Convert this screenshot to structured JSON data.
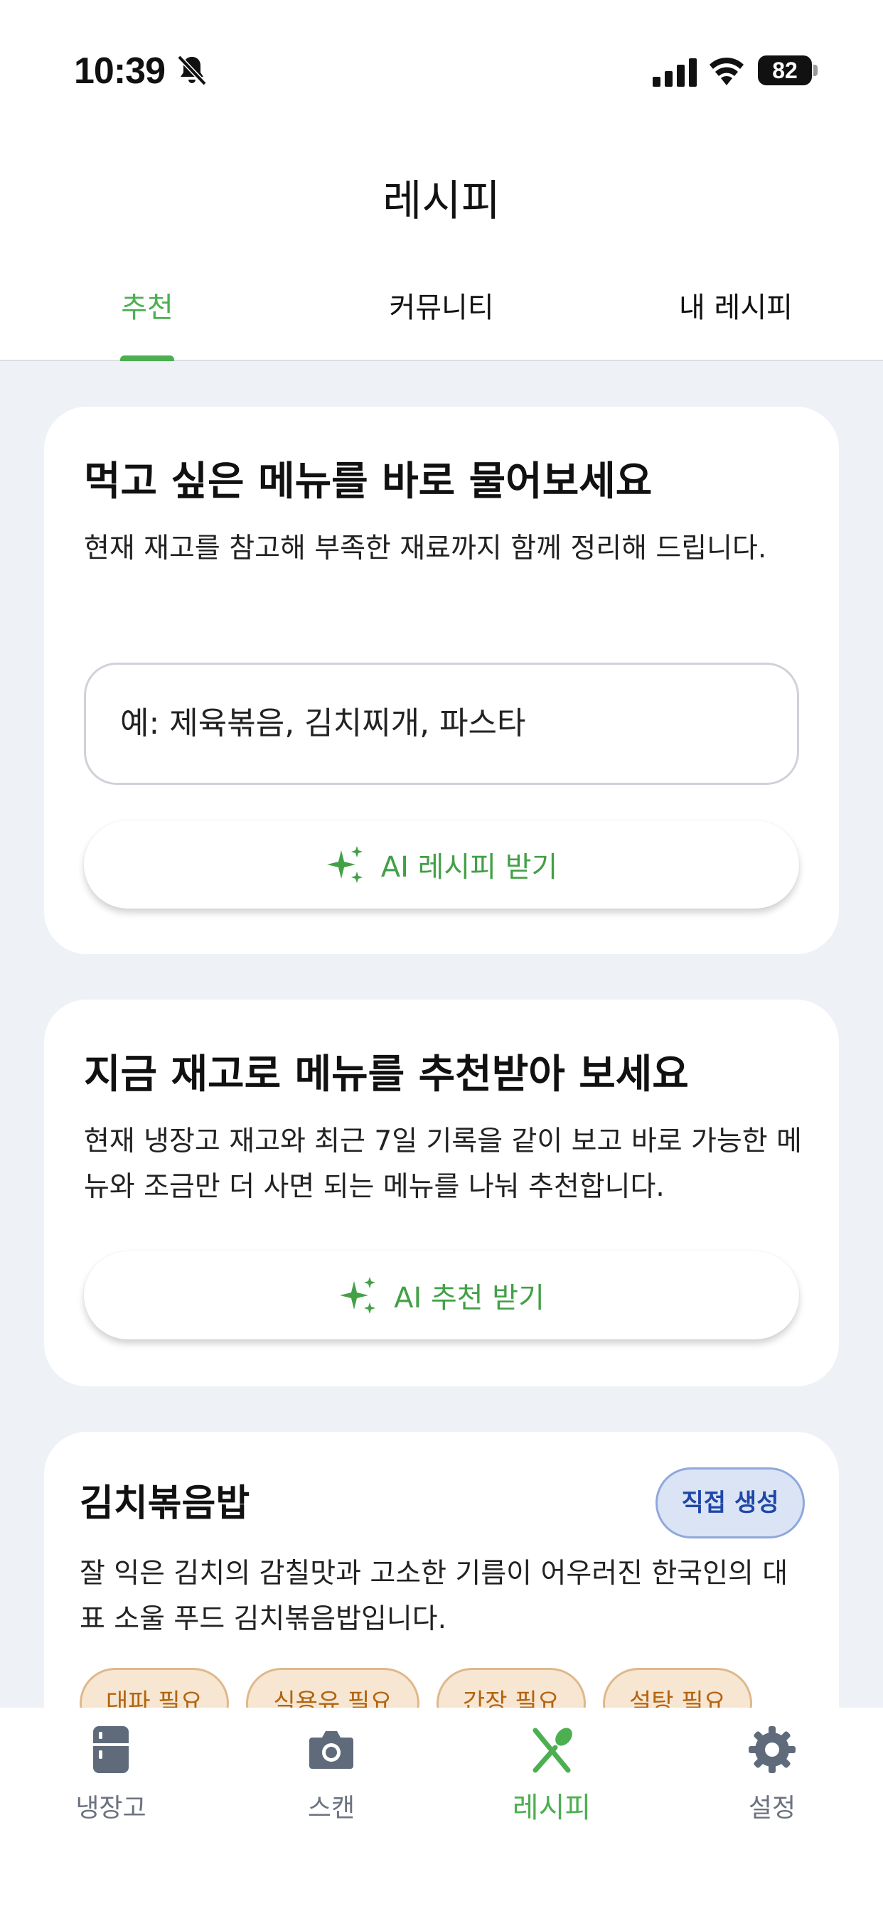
{
  "status_bar": {
    "time": "10:39",
    "battery": "82"
  },
  "header": {
    "title": "레시피",
    "tabs": [
      {
        "label": "추천",
        "active": true
      },
      {
        "label": "커뮤니티",
        "active": false
      },
      {
        "label": "내 레시피",
        "active": false
      }
    ]
  },
  "ask_card": {
    "title": "먹고 싶은 메뉴를 바로 물어보세요",
    "description": "현재 재고를 참고해 부족한 재료까지 함께 정리해 드립니다.",
    "input_placeholder": "예: 제육볶음, 김치찌개, 파스타",
    "button_label": "AI 레시피 받기"
  },
  "recommend_card": {
    "title": "지금 재고로 메뉴를 추천받아 보세요",
    "description": "현재 냉장고 재고와 최근 7일 기록을 같이 보고 바로 가능한 메뉴와 조금만 더 사면 되는 메뉴를 나눠 추천합니다.",
    "button_label": "AI 추천 받기"
  },
  "recipe_card": {
    "title": "김치볶음밥",
    "badge": "직접 생성",
    "description": "잘 익은 김치의 감칠맛과 고소한 기름이 어우러진 한국인의 대표 소울 푸드 김치볶음밥입니다.",
    "chips": [
      "대파 필요",
      "식용유 필요",
      "간장 필요",
      "설탕 필요"
    ]
  },
  "bottom_nav": {
    "items": [
      {
        "label": "냉장고",
        "icon": "fridge-icon"
      },
      {
        "label": "스캔",
        "icon": "camera-icon"
      },
      {
        "label": "레시피",
        "icon": "utensils-icon",
        "active": true
      },
      {
        "label": "설정",
        "icon": "gear-icon"
      }
    ]
  },
  "colors": {
    "accent": "#4caf50",
    "background": "#eef1f6",
    "badge_bg": "#dbe4f5",
    "chip_bg": "#f7e6d2",
    "chip_text": "#b3640f",
    "nav_icon": "#5f6b7a"
  }
}
